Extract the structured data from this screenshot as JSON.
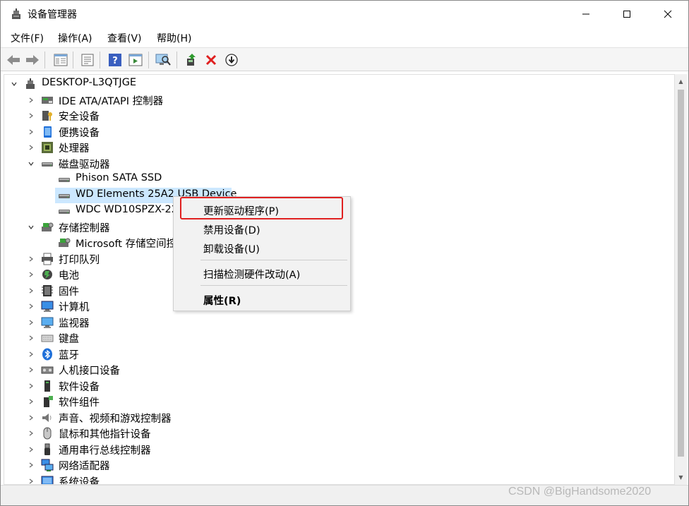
{
  "window": {
    "title": "设备管理器",
    "controls": {
      "minimize": "—",
      "maximize": "☐",
      "close": "✕"
    }
  },
  "menu": [
    {
      "label": "文件(F)"
    },
    {
      "label": "操作(A)"
    },
    {
      "label": "查看(V)"
    },
    {
      "label": "帮助(H)"
    }
  ],
  "toolbar": {
    "icons": [
      "back-arrow-icon",
      "forward-arrow-icon",
      "show-hide-console-tree-icon",
      "properties-icon",
      "help-icon",
      "run-action-icon",
      "scan-hardware-icon",
      "update-driver-icon",
      "uninstall-device-icon",
      "disable-device-icon"
    ]
  },
  "tree": {
    "root": "DESKTOP-L3QTJGE",
    "items": [
      {
        "label": "IDE ATA/ATAPI 控制器",
        "icon": "ide-controller-icon",
        "expanded": false
      },
      {
        "label": "安全设备",
        "icon": "security-device-icon",
        "expanded": false
      },
      {
        "label": "便携设备",
        "icon": "portable-device-icon",
        "expanded": false
      },
      {
        "label": "处理器",
        "icon": "processor-icon",
        "expanded": false
      },
      {
        "label": "磁盘驱动器",
        "icon": "disk-drive-icon",
        "expanded": true
      },
      {
        "label": "Phison SATA SSD",
        "icon": "disk-drive-icon",
        "child": true
      },
      {
        "label": "WD Elements 25A2 USB Device",
        "icon": "disk-drive-icon",
        "child": true,
        "selected": true
      },
      {
        "label": "WDC WD10SPZX-22",
        "icon": "disk-drive-icon",
        "child": true
      },
      {
        "label": "存储控制器",
        "icon": "storage-controller-icon",
        "expanded": true
      },
      {
        "label": "Microsoft 存储空间控",
        "icon": "storage-controller-icon",
        "child": true
      },
      {
        "label": "打印队列",
        "icon": "printer-icon",
        "expanded": false
      },
      {
        "label": "电池",
        "icon": "battery-icon",
        "expanded": false
      },
      {
        "label": "固件",
        "icon": "firmware-icon",
        "expanded": false
      },
      {
        "label": "计算机",
        "icon": "computer-icon",
        "expanded": false
      },
      {
        "label": "监视器",
        "icon": "monitor-icon",
        "expanded": false
      },
      {
        "label": "键盘",
        "icon": "keyboard-icon",
        "expanded": false
      },
      {
        "label": "蓝牙",
        "icon": "bluetooth-icon",
        "expanded": false
      },
      {
        "label": "人机接口设备",
        "icon": "hid-icon",
        "expanded": false
      },
      {
        "label": "软件设备",
        "icon": "software-device-icon",
        "expanded": false
      },
      {
        "label": "软件组件",
        "icon": "software-component-icon",
        "expanded": false
      },
      {
        "label": "声音、视频和游戏控制器",
        "icon": "sound-icon",
        "expanded": false
      },
      {
        "label": "鼠标和其他指针设备",
        "icon": "mouse-icon",
        "expanded": false
      },
      {
        "label": "通用串行总线控制器",
        "icon": "usb-icon",
        "expanded": false
      },
      {
        "label": "网络适配器",
        "icon": "network-adapter-icon",
        "expanded": false
      },
      {
        "label": "系统设备",
        "icon": "system-device-icon",
        "expanded": false
      }
    ]
  },
  "context_menu": {
    "items": [
      {
        "label": "更新驱动程序(P)",
        "highlighted": true
      },
      {
        "label": "禁用设备(D)"
      },
      {
        "label": "卸载设备(U)"
      },
      {
        "label": "扫描检测硬件改动(A)"
      },
      {
        "label": "属性(R)",
        "bold": true
      }
    ]
  },
  "watermark": "CSDN @BigHandsome2020",
  "colors": {
    "selection": "#cce8ff",
    "highlight_border": "#e02020",
    "toolbar_bg": "#f5f5f5",
    "context_bg": "#f2f2f2"
  }
}
